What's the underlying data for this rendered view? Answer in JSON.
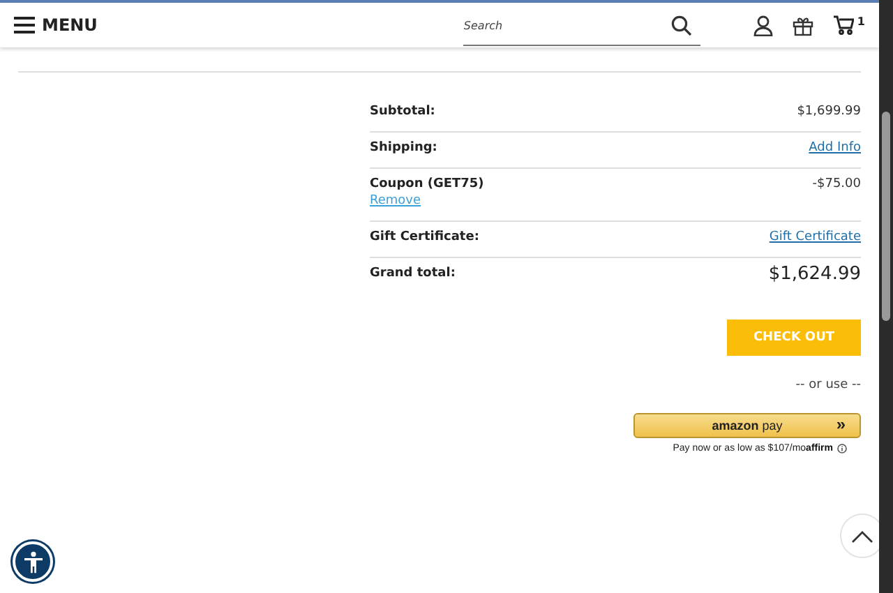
{
  "header": {
    "menu_label": "MENU",
    "search": {
      "placeholder": "Search"
    },
    "cart_count": "1"
  },
  "summary": [
    {
      "kind": "amount",
      "label": "Subtotal:",
      "value": "$1,699.99"
    },
    {
      "kind": "link",
      "label": "Shipping:",
      "value": "Add Info"
    },
    {
      "kind": "coupon",
      "label": "Coupon (GET75)",
      "action": "Remove",
      "value": "-$75.00"
    },
    {
      "kind": "link",
      "label": "Gift Certificate:",
      "value": "Gift Certificate"
    },
    {
      "kind": "total",
      "label": "Grand total:",
      "value": "$1,624.99"
    }
  ],
  "checkout_button": "CHECK OUT",
  "or_use": "-- or use --",
  "amazon_pay": {
    "brand": "amazon",
    "suffix": "pay",
    "arrow": "»"
  },
  "affirm": {
    "text": "Pay now or as low as $107/mo",
    "brand": "affirm"
  }
}
